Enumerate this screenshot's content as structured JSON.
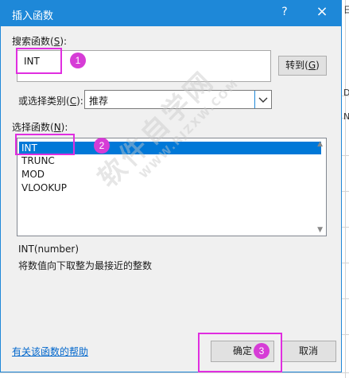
{
  "dialog": {
    "title": "插入函数",
    "help_glyph": "?",
    "close_glyph": "×"
  },
  "search": {
    "label_prefix": "搜索函数(",
    "label_key": "S",
    "label_suffix": "):",
    "value": "INT",
    "goto_label_prefix": "转到(",
    "goto_label_key": "G",
    "goto_label_suffix": ")"
  },
  "category": {
    "label_prefix": "或选择类别(",
    "label_key": "C",
    "label_suffix": "):",
    "value": "推荐"
  },
  "function_list": {
    "label_prefix": "选择函数(",
    "label_key": "N",
    "label_suffix": "):",
    "items": [
      "INT",
      "TRUNC",
      "MOD",
      "VLOOKUP"
    ],
    "selected_index": 0
  },
  "description": {
    "signature": "INT(number)",
    "text": "将数值向下取整为最接近的整数"
  },
  "footer": {
    "help_link": "有关该函数的帮助",
    "ok_label": "确定",
    "cancel_label": "取消"
  },
  "annotations": {
    "badges": [
      "1",
      "2",
      "3"
    ],
    "highlight_color": "#e02ee0",
    "badge_color": "#d63cd6"
  },
  "watermark": {
    "text": "软件自学网",
    "sub": "WWW.RJZXW.COM"
  },
  "background_sheet": {
    "fragments": [
      "日",
      "D",
      "N"
    ]
  },
  "colors": {
    "titlebar": "#1e88d8",
    "selection": "#0078d7",
    "link": "#0066cc"
  }
}
